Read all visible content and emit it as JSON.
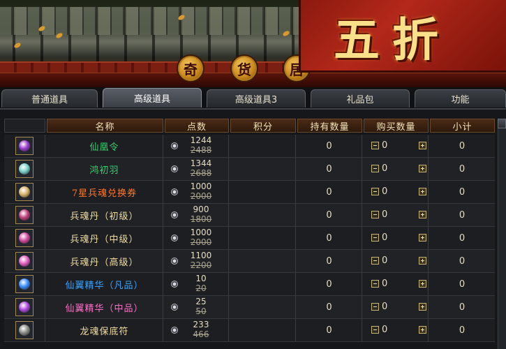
{
  "banner": {
    "shop_chars": [
      "奇",
      "货",
      "居"
    ],
    "sale_text": "五折"
  },
  "tabs": [
    {
      "label": "普通道具",
      "active": false
    },
    {
      "label": "高级道具",
      "active": true
    },
    {
      "label": "高级道具3",
      "active": false
    },
    {
      "label": "礼品包",
      "active": false
    },
    {
      "label": "功能",
      "active": false
    }
  ],
  "columns": {
    "name": "名称",
    "points": "点数",
    "score": "积分",
    "held": "持有数量",
    "buy": "购买数量",
    "subtotal": "小计"
  },
  "colors": {
    "green": "#35d46a",
    "orange": "#ff7a2a",
    "gold": "#f2dea0",
    "blue": "#3aa4ff",
    "pink": "#ff6fc8"
  },
  "items": [
    {
      "name": "仙凰令",
      "color": "#35d46a",
      "icon": "purple-seal-icon",
      "gem": "#9b3fd1",
      "points": "1244",
      "old_points": "2488",
      "held": "0",
      "buy_qty": "0",
      "subtotal": "0"
    },
    {
      "name": "鸿初羽",
      "color": "#35d46a",
      "icon": "feather-icon",
      "gem": "#7ad0c8",
      "points": "1344",
      "old_points": "2688",
      "held": "0",
      "buy_qty": "0",
      "subtotal": "0"
    },
    {
      "name": "7星兵魂兑换券",
      "color": "#ff7a2a",
      "icon": "scroll-icon",
      "gem": "#d6b36a",
      "points": "1000",
      "old_points": "2000",
      "held": "0",
      "buy_qty": "0",
      "subtotal": "0"
    },
    {
      "name": "兵魂丹（初级）",
      "color": "#f2dea0",
      "icon": "pill-icon",
      "gem": "#c0407a",
      "points": "900",
      "old_points": "1800",
      "held": "0",
      "buy_qty": "0",
      "subtotal": "0"
    },
    {
      "name": "兵魂丹（中级）",
      "color": "#f2dea0",
      "icon": "pill-icon",
      "gem": "#d24aa0",
      "points": "1000",
      "old_points": "2000",
      "held": "0",
      "buy_qty": "0",
      "subtotal": "0"
    },
    {
      "name": "兵魂丹（高级）",
      "color": "#f2dea0",
      "icon": "pill-icon",
      "gem": "#e060c0",
      "points": "1100",
      "old_points": "2200",
      "held": "0",
      "buy_qty": "0",
      "subtotal": "0"
    },
    {
      "name": "仙翼精华（凡品）",
      "color": "#3aa4ff",
      "icon": "blue-orb-icon",
      "gem": "#3a8cff",
      "points": "10",
      "old_points": "20",
      "held": "0",
      "buy_qty": "0",
      "subtotal": "0"
    },
    {
      "name": "仙翼精华（中品）",
      "color": "#ff6fc8",
      "icon": "purple-orb-icon",
      "gem": "#b04adf",
      "points": "25",
      "old_points": "50",
      "held": "0",
      "buy_qty": "0",
      "subtotal": "0"
    },
    {
      "name": "龙魂保底符",
      "color": "#f2dea0",
      "icon": "stone-tablet-icon",
      "gem": "#8a8d86",
      "points": "233",
      "old_points": "466",
      "held": "0",
      "buy_qty": "0",
      "subtotal": "0"
    }
  ]
}
